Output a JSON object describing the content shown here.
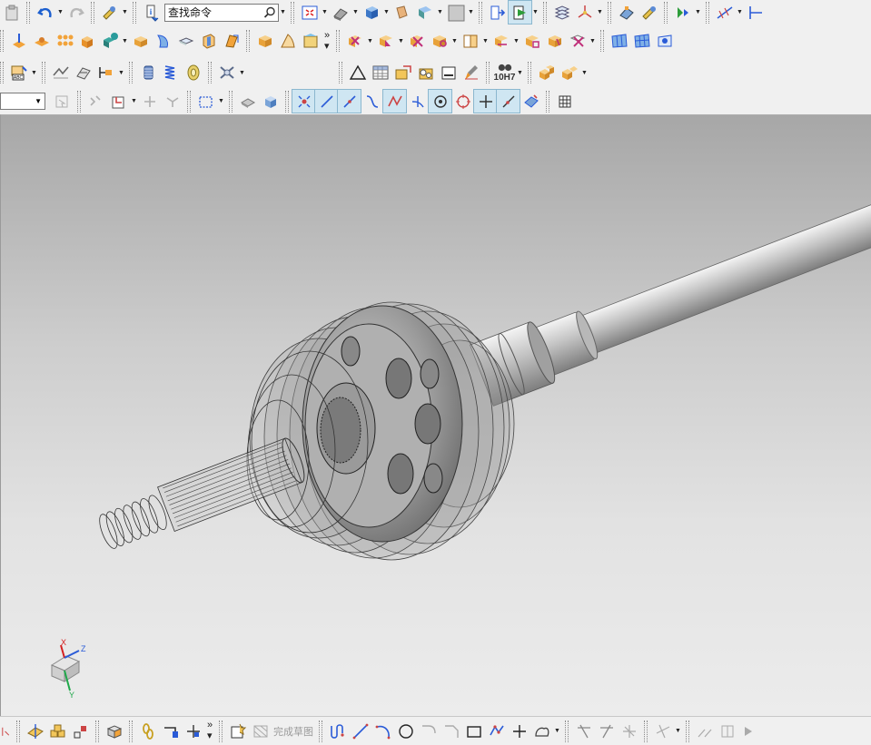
{
  "app": {
    "search": {
      "value": "查找命令"
    },
    "layer_select": {
      "value": ""
    },
    "tolerance_label": "10H7",
    "sketch_finish_label": "完成草图"
  },
  "icons": {
    "row1": [
      "paste-icon",
      "undo-icon",
      "redo-icon",
      "selection-filter-icon",
      "info-icon",
      "fit-view-icon",
      "shade-mode-icon",
      "solid-view-icon",
      "hide-icon",
      "section-view-icon",
      "background-icon",
      "work-view-icon",
      "drafting-view-icon",
      "layer-icon",
      "wcs-icon",
      "assembly-icon",
      "feature-icon",
      "mirror-icon",
      "dimension-icon",
      "edge-icon"
    ],
    "row2": [
      "datum-icon",
      "boss-icon",
      "pattern-icon",
      "extrude-icon",
      "combine-icon",
      "block-icon",
      "face-icon",
      "shell-icon",
      "chamfer-icon",
      "sweep-icon",
      "blend-icon",
      "fold-icon",
      "surface-icon",
      "sync-move-icon",
      "sync-offset-icon",
      "sync-delete-icon",
      "sync-replace-icon",
      "sync-resize-icon",
      "sync-pattern-icon",
      "sync-group-icon",
      "sync-detail-icon",
      "sync-linear-icon",
      "surface-grid-icon",
      "surface-mesh-icon",
      "surface-trim-icon"
    ],
    "row3": [
      "text-icon",
      "sheet-metal-icon",
      "thicken-icon",
      "shape-icon",
      "cylinder-icon",
      "spring-icon",
      "gear-icon",
      "bearing-icon",
      "triangle-icon",
      "table-icon",
      "note-icon",
      "callout-icon",
      "frame-icon",
      "brush-icon",
      "binoculars-icon",
      "assembly-box-icon",
      "assembly-group-icon"
    ],
    "row4": [
      "select-arrow-icon",
      "snap-icon",
      "filter-icon",
      "rotate-icon",
      "rectangle-select-icon",
      "shade-icon",
      "view-cube-icon",
      "snap-point-icon",
      "snap-line-icon",
      "snap-end-icon",
      "curve-icon",
      "vertex-icon",
      "intersect-icon",
      "center-icon",
      "quadrant-icon",
      "crosshair-icon",
      "line-snap-icon",
      "face-snap-icon",
      "grid-icon"
    ],
    "bottom": [
      "pipe-icon",
      "sketch-section-icon",
      "sketch-group-icon",
      "sketch-step-icon",
      "sketch-box-icon",
      "sketch-chain-icon",
      "sketch-bracket-icon",
      "sketch-hanger-icon",
      "sketch-frame-icon",
      "sketch-flag-icon",
      "profile-icon",
      "line-icon",
      "arc-icon",
      "circle-icon",
      "fillet-icon",
      "chamfer-line-icon",
      "rectangle-icon",
      "polygon-icon",
      "point-icon",
      "offset-icon",
      "trim-icon",
      "extend-icon",
      "split-icon",
      "constraint-icon",
      "mirror-line-icon",
      "dimension-line-icon",
      "bottom-more-icon"
    ]
  },
  "triad": {
    "x_label": "X",
    "y_label": "Y",
    "z_label": "Z",
    "x_color": "#d42020",
    "y_color": "#1fa84a",
    "z_color": "#2a5bd7"
  },
  "colors": {
    "toolbar_bg": "#f0f0f0",
    "active_btn": "#cfe6f2",
    "viewport_top": "#a7a7a7",
    "viewport_bottom": "#ececec"
  }
}
